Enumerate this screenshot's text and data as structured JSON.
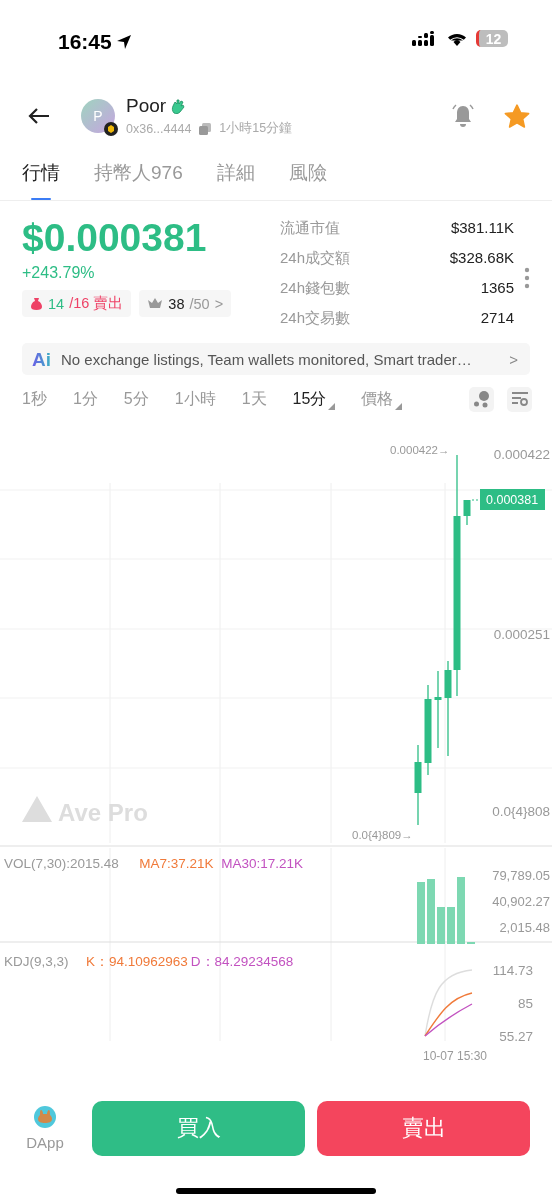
{
  "status_bar": {
    "time": "16:45",
    "battery": "12"
  },
  "token": {
    "name": "Poor",
    "avatar_letter": "P",
    "address": "0x36...4444",
    "age": "1小時15分鐘",
    "favorite": true
  },
  "tabs": [
    {
      "label": "行情",
      "selected": true
    },
    {
      "label": "持幣人976",
      "selected": false
    },
    {
      "label": "詳細",
      "selected": false
    },
    {
      "label": "風險",
      "selected": false
    }
  ],
  "price": {
    "value": "$0.000381",
    "change": "+243.79%",
    "holders_badge": {
      "buys": "14",
      "sells": "/16",
      "label": "賣出"
    },
    "top_badge": {
      "count": "38",
      "total": "/50",
      "chevron": ">"
    }
  },
  "stats": [
    {
      "label": "流通市值",
      "value": "$381.11K"
    },
    {
      "label": "24h成交額",
      "value": "$328.68K"
    },
    {
      "label": "24h錢包數",
      "value": "1365"
    },
    {
      "label": "24h交易數",
      "value": "2714"
    }
  ],
  "ai_banner": {
    "badge": "Ai",
    "text": "No exchange listings, Team wallets monitored, Smart trader…",
    "chevron": ">"
  },
  "intervals": [
    {
      "label": "1秒",
      "selected": false,
      "dropdown": false
    },
    {
      "label": "1分",
      "selected": false,
      "dropdown": false
    },
    {
      "label": "5分",
      "selected": false,
      "dropdown": false
    },
    {
      "label": "1小時",
      "selected": false,
      "dropdown": false
    },
    {
      "label": "1天",
      "selected": false,
      "dropdown": false
    },
    {
      "label": "15分",
      "selected": true,
      "dropdown": true
    },
    {
      "label": "價格",
      "selected": false,
      "dropdown": true
    }
  ],
  "chart": {
    "axis_labels": [
      "0.000422",
      "0.000251",
      "0.0{4}808"
    ],
    "high_marker": "0.000422→",
    "low_marker": "0.0{4}809→",
    "price_tag": "0.000381",
    "watermark": "Ave Pro"
  },
  "volume": {
    "legend": [
      {
        "text": "VOL(7,30):2015.48",
        "color": "#999999"
      },
      {
        "text": "MA7:37.21K",
        "color": "#f07a3a"
      },
      {
        "text": "MA30:17.21K",
        "color": "#c252c0"
      }
    ],
    "axis_labels": [
      "79,789.05",
      "40,902.27",
      "2,015.48"
    ]
  },
  "kdj": {
    "legend": [
      {
        "text": "KDJ(9,3,3)",
        "color": "#999999"
      },
      {
        "text": "K：94.10962963",
        "color": "#f07a3a"
      },
      {
        "text": "D：84.29234568",
        "color": "#c252c0"
      }
    ],
    "axis_labels": [
      "114.73",
      "85",
      "55.27"
    ],
    "time_label": "10-07 15:30"
  },
  "bottom": {
    "dapp_label": "DApp",
    "buy": "買入",
    "sell": "賣出"
  }
}
